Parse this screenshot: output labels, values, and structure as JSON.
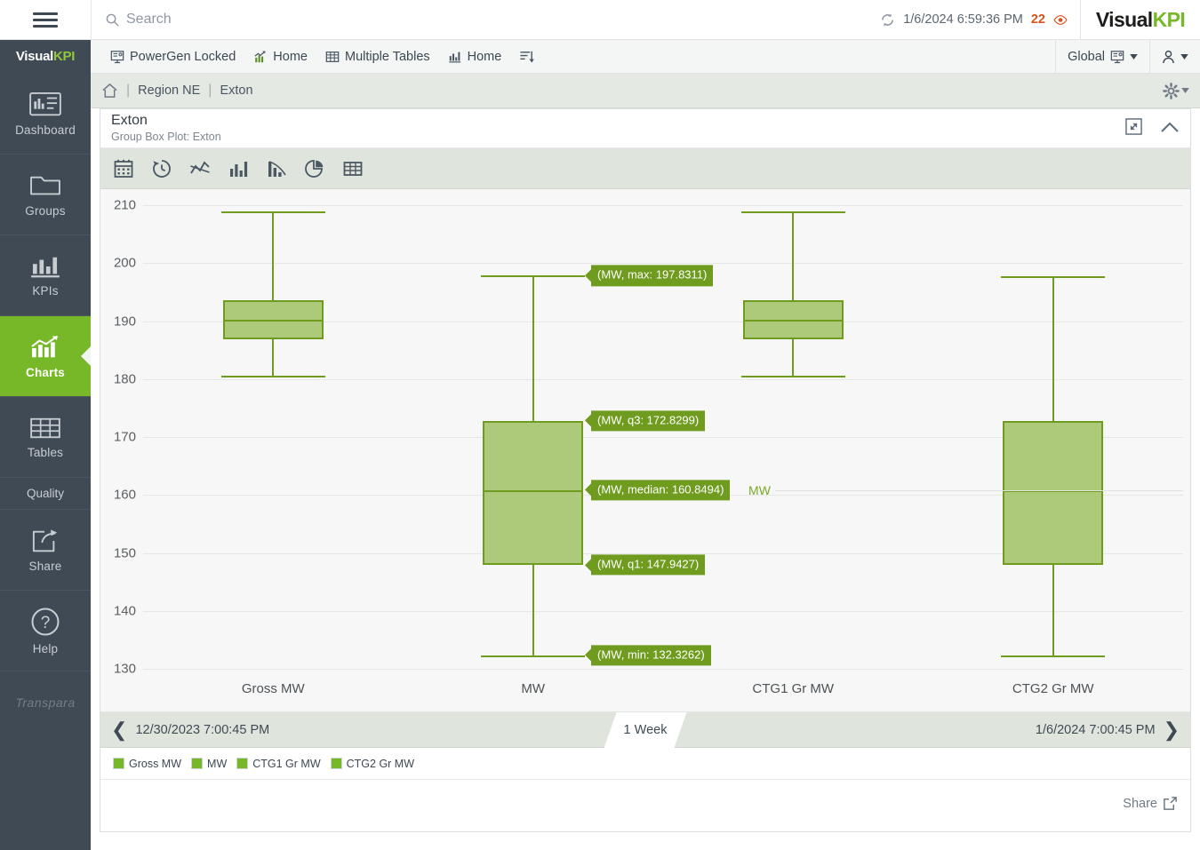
{
  "topbar": {
    "hamburger": "menu-icon",
    "search_placeholder": "Search",
    "refresh_timestamp": "1/6/2024 6:59:36 PM",
    "view_count": "22",
    "brand_first": "Visual",
    "brand_second": "KPI"
  },
  "navbar": {
    "logo_first": "Visual",
    "logo_second": "KPI",
    "items": [
      {
        "label": "PowerGen Locked",
        "icon": "monitor-icon"
      },
      {
        "label": "Home",
        "icon": "trend-chart-icon"
      },
      {
        "label": "Multiple Tables",
        "icon": "table-icon"
      },
      {
        "label": "Home",
        "icon": "bar-chart-icon"
      },
      {
        "label": "",
        "icon": "sort-list-icon"
      }
    ],
    "global_label": "Global",
    "user_label": ""
  },
  "sidebar": {
    "items": [
      {
        "label": "Dashboard",
        "icon": "dashboard-icon",
        "active": false
      },
      {
        "label": "Groups",
        "icon": "folder-icon",
        "active": false
      },
      {
        "label": "KPIs",
        "icon": "bar-chart-icon",
        "active": false
      },
      {
        "label": "Charts",
        "icon": "chart-trend-icon",
        "active": true
      },
      {
        "label": "Tables",
        "icon": "grid-table-icon",
        "active": false
      }
    ],
    "quality_label": "Quality",
    "share": {
      "label": "Share",
      "icon": "share-arrow-icon"
    },
    "help": {
      "label": "Help",
      "icon": "question-circle-icon"
    },
    "footer_logo": "Transpara"
  },
  "breadcrumb": {
    "home_icon": "home-icon",
    "region": "Region NE",
    "node": "Exton",
    "gear_icon": "gear-icon"
  },
  "panel": {
    "title": "Exton",
    "subtitle": "Group Box Plot: Exton",
    "expand_icon": "expand-icon",
    "collapse_icon": "chevron-up-icon",
    "toolbar_icons": [
      "calendar-icon",
      "history-clock-icon",
      "line-chart-icon",
      "column-chart-icon",
      "mixed-chart-icon",
      "pie-chart-icon",
      "table-grid-icon"
    ]
  },
  "timerange": {
    "start": "12/30/2023 7:00:45 PM",
    "duration": "1 Week",
    "end": "1/6/2024 7:00:45 PM",
    "prev_icon": "chevron-left-icon",
    "next_icon": "chevron-right-icon"
  },
  "legend": {
    "items": [
      "Gross MW",
      "MW",
      "CTG1 Gr MW",
      "CTG2 Gr MW"
    ],
    "color": "#76b828"
  },
  "footer": {
    "share_label": "Share",
    "share_icon": "share-external-icon"
  },
  "chart_data": {
    "type": "box",
    "title": "Group Box Plot: Exton",
    "xlabel": "",
    "ylabel": "MW",
    "unit_label": "MW",
    "ylim": [
      130,
      210
    ],
    "yticks": [
      130,
      140,
      150,
      160,
      170,
      180,
      190,
      200,
      210
    ],
    "grid": true,
    "legend_position": "bottom",
    "box_color": "#adca7b",
    "line_color": "#6f9c1e",
    "categories": [
      "Gross MW",
      "MW",
      "CTG1 Gr MW",
      "CTG2 Gr MW"
    ],
    "boxes": [
      {
        "name": "Gross MW",
        "min": 180.5,
        "q1": 186.9,
        "median": 190.3,
        "q3": 193.6,
        "max": 209.0
      },
      {
        "name": "MW",
        "min": 132.3262,
        "q1": 147.9427,
        "median": 160.8494,
        "q3": 172.8299,
        "max": 197.8311
      },
      {
        "name": "CTG1 Gr MW",
        "min": 180.5,
        "q1": 186.9,
        "median": 190.3,
        "q3": 193.6,
        "max": 209.0
      },
      {
        "name": "CTG2 Gr MW",
        "min": 132.3,
        "q1": 147.9,
        "median": 160.8,
        "q3": 172.8,
        "max": 197.8
      }
    ],
    "annotations": [
      {
        "text": "(MW, max: 197.8311)",
        "value": 197.8311
      },
      {
        "text": "(MW, q3: 172.8299)",
        "value": 172.8299
      },
      {
        "text": "(MW, median: 160.8494)",
        "value": 160.8494
      },
      {
        "text": "(MW, q1: 147.9427)",
        "value": 147.9427
      },
      {
        "text": "(MW, min: 132.3262)",
        "value": 132.3262
      }
    ]
  }
}
